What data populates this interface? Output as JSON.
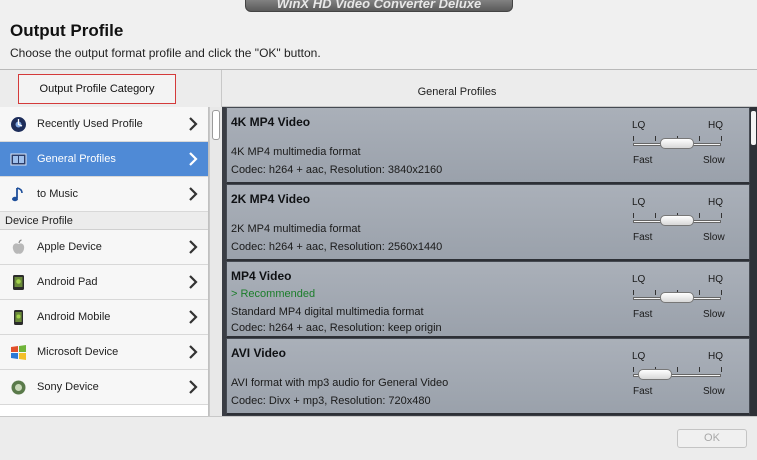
{
  "window": {
    "title": "WinX HD Video Converter Deluxe"
  },
  "header": {
    "title": "Output Profile",
    "subtitle": "Choose the output format profile and click the \"OK\" button."
  },
  "columns": {
    "left_header": "Output Profile Category",
    "right_header": "General Profiles"
  },
  "categories": [
    {
      "label": "Recently Used Profile",
      "icon": "recent-disc-icon",
      "selected": false
    },
    {
      "label": "General Profiles",
      "icon": "film-icon",
      "selected": true
    },
    {
      "label": "to Music",
      "icon": "music-note-icon",
      "selected": false
    }
  ],
  "device_section": {
    "label": "Device Profile",
    "items": [
      {
        "label": "Apple Device",
        "icon": "apple-icon"
      },
      {
        "label": "Android Pad",
        "icon": "android-icon"
      },
      {
        "label": "Android Mobile",
        "icon": "android-icon"
      },
      {
        "label": "Microsoft Device",
        "icon": "windows-icon"
      },
      {
        "label": "Sony Device",
        "icon": "sony-icon"
      }
    ]
  },
  "profiles": [
    {
      "name": "4K MP4 Video",
      "recommended": "",
      "desc": "4K MP4 multimedia format",
      "codec": "Codec: h264 + aac, Resolution: 3840x2160",
      "quality": 0.5
    },
    {
      "name": "2K MP4 Video",
      "recommended": "",
      "desc": "2K MP4 multimedia format",
      "codec": "Codec: h264 + aac, Resolution: 2560x1440",
      "quality": 0.5
    },
    {
      "name": "MP4 Video",
      "recommended": "> Recommended",
      "desc": "Standard MP4 digital multimedia format",
      "codec": "Codec: h264 + aac, Resolution: keep origin",
      "quality": 0.5
    },
    {
      "name": "AVI Video",
      "recommended": "",
      "desc": "AVI format with mp3 audio for  General Video",
      "codec": "Codec: Divx + mp3, Resolution: 720x480",
      "quality": 0.25
    }
  ],
  "slider_labels": {
    "lq": "LQ",
    "hq": "HQ",
    "fast": "Fast",
    "slow": "Slow"
  },
  "footer": {
    "ok_label": "OK",
    "ok_enabled": false
  },
  "colors": {
    "selected": "#4f8ad6",
    "recommended": "#1b7d2a",
    "highlight_border": "#d43a3a"
  }
}
